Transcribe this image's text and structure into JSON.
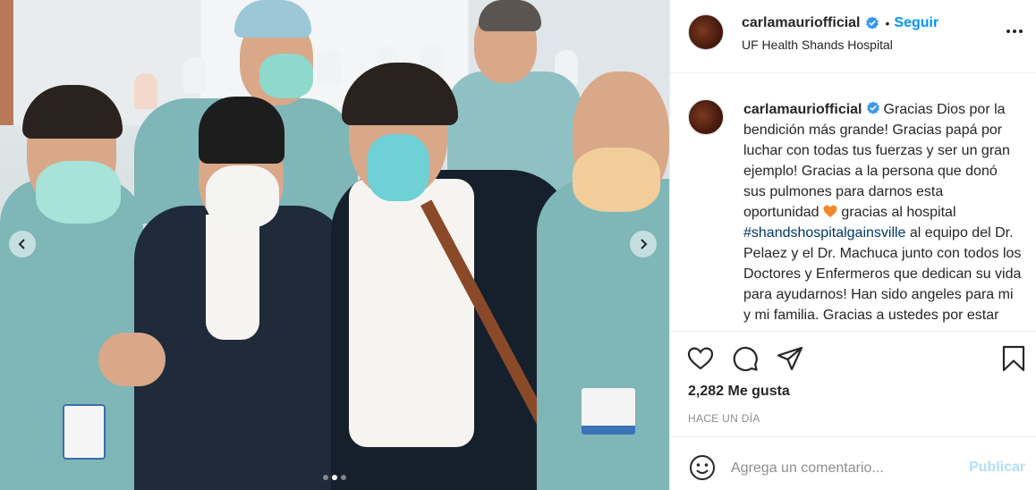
{
  "post": {
    "photo_alt_icon": "hospital-group-photo",
    "carousel": {
      "total_slides": 3,
      "active_slide": 2
    }
  },
  "header": {
    "username": "carlamauriofficial",
    "separator": "•",
    "follow_label": "Seguir",
    "location": "UF Health Shands Hospital"
  },
  "caption": {
    "username": "carlamauriofficial",
    "text_1": "Gracias Dios por la bendición más grande! Gracias papá por luchar con todas tus fuerzas y ser un gran ejemplo! Gracias a la persona que donó sus pulmones para darnos esta oportunidad",
    "text_2": "gracias al hospital",
    "hashtag": "#shandshospitalgainsville",
    "text_3": "al equipo del Dr. Pelaez y el Dr. Machuca junto con todos los Doctores y Enfermeros que dedican su vida para ayudarnos! Han sido angeles para mi y mi familia. Gracias a ustedes por estar"
  },
  "stats": {
    "likes": "2,282 Me gusta",
    "time": "HACE UN DÍA"
  },
  "comment": {
    "placeholder": "Agrega un comentario...",
    "publish_label": "Publicar"
  },
  "colors": {
    "accent": "#0095f6",
    "publish_disabled": "#b2dffc",
    "verified": "#3897f0",
    "heart_emoji": "#f08a2c"
  }
}
